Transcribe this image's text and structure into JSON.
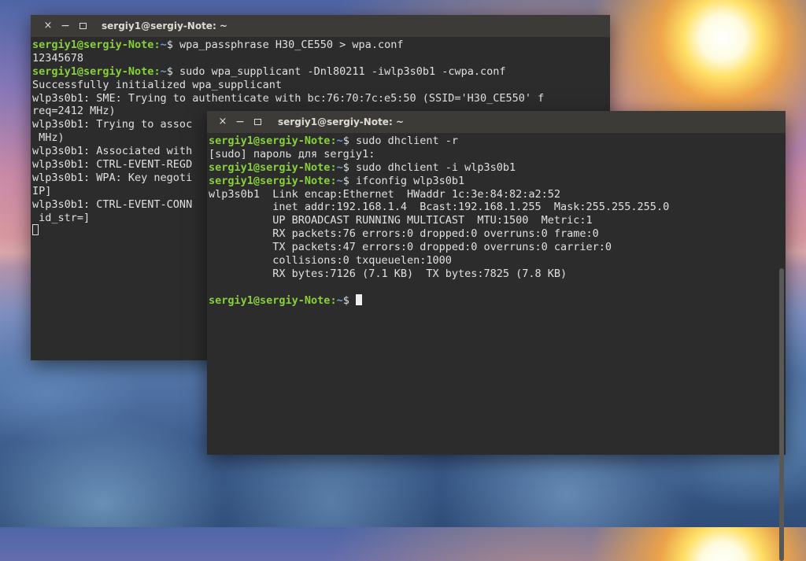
{
  "back_window": {
    "title": "sergiy1@sergiy-Note: ~",
    "buttons": {
      "close": "×",
      "minimize": "−"
    },
    "lines": [
      {
        "kind": "prompt",
        "user": "sergiy1@sergiy-Note",
        "path": "~",
        "cmd": "wpa_passphrase H30_CE550 > wpa.conf"
      },
      {
        "kind": "text",
        "text": "12345678"
      },
      {
        "kind": "prompt",
        "user": "sergiy1@sergiy-Note",
        "path": "~",
        "cmd": "sudo wpa_supplicant -Dnl80211 -iwlp3s0b1 -cwpa.conf"
      },
      {
        "kind": "text",
        "text": "Successfully initialized wpa_supplicant"
      },
      {
        "kind": "text",
        "text": "wlp3s0b1: SME: Trying to authenticate with bc:76:70:7c:e5:50 (SSID='H30_CE550' f"
      },
      {
        "kind": "text",
        "text": "req=2412 MHz)"
      },
      {
        "kind": "text",
        "text": "wlp3s0b1: Trying to assoc"
      },
      {
        "kind": "text",
        "text": " MHz)"
      },
      {
        "kind": "text",
        "text": "wlp3s0b1: Associated with"
      },
      {
        "kind": "text",
        "text": "wlp3s0b1: CTRL-EVENT-REGD"
      },
      {
        "kind": "text",
        "text": "wlp3s0b1: WPA: Key negoti"
      },
      {
        "kind": "text",
        "text": "IP]"
      },
      {
        "kind": "text",
        "text": "wlp3s0b1: CTRL-EVENT-CONN"
      },
      {
        "kind": "text",
        "text": " id_str=]"
      },
      {
        "kind": "cursor"
      }
    ]
  },
  "front_window": {
    "title": "sergiy1@sergiy-Note: ~",
    "buttons": {
      "close": "×",
      "minimize": "−"
    },
    "lines": [
      {
        "kind": "prompt",
        "user": "sergiy1@sergiy-Note",
        "path": "~",
        "cmd": "sudo dhclient -r"
      },
      {
        "kind": "text",
        "text": "[sudo] пароль для sergiy1:"
      },
      {
        "kind": "prompt",
        "user": "sergiy1@sergiy-Note",
        "path": "~",
        "cmd": "sudo dhclient -i wlp3s0b1"
      },
      {
        "kind": "prompt",
        "user": "sergiy1@sergiy-Note",
        "path": "~",
        "cmd": "ifconfig wlp3s0b1"
      },
      {
        "kind": "text",
        "text": "wlp3s0b1  Link encap:Ethernet  HWaddr 1c:3e:84:82:a2:52"
      },
      {
        "kind": "text",
        "text": "          inet addr:192.168.1.4  Bcast:192.168.1.255  Mask:255.255.255.0"
      },
      {
        "kind": "text",
        "text": "          UP BROADCAST RUNNING MULTICAST  MTU:1500  Metric:1"
      },
      {
        "kind": "text",
        "text": "          RX packets:76 errors:0 dropped:0 overruns:0 frame:0"
      },
      {
        "kind": "text",
        "text": "          TX packets:47 errors:0 dropped:0 overruns:0 carrier:0"
      },
      {
        "kind": "text",
        "text": "          collisions:0 txqueuelen:1000"
      },
      {
        "kind": "text",
        "text": "          RX bytes:7126 (7.1 KB)  TX bytes:7825 (7.8 KB)"
      },
      {
        "kind": "text",
        "text": ""
      },
      {
        "kind": "prompt",
        "user": "sergiy1@sergiy-Note",
        "path": "~",
        "cmd": "",
        "cursor": true
      }
    ]
  }
}
